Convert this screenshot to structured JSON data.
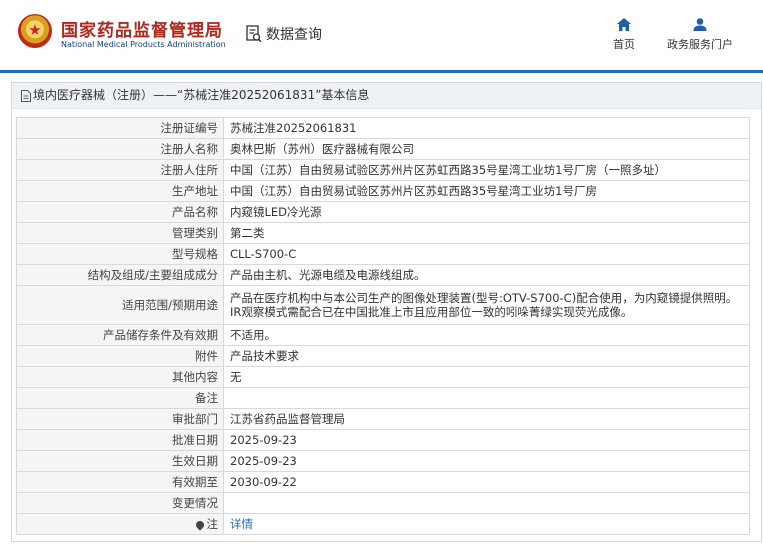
{
  "header": {
    "brand_cn": "国家药品监督管理局",
    "brand_en": "National Medical Products Administration",
    "query_label": "数据查询",
    "nav": [
      {
        "label": "首页",
        "icon": "home-icon"
      },
      {
        "label": "政务服务门户",
        "icon": "user-icon"
      }
    ],
    "accent": "#1b6fc0",
    "brand_color": "#b2271d"
  },
  "breadcrumb": "境内医疗器械（注册）——“苏械注准20252061831”基本信息",
  "fields": [
    {
      "label": "注册证编号",
      "value": "苏械注准20252061831"
    },
    {
      "label": "注册人名称",
      "value": "奥林巴斯（苏州）医疗器械有限公司"
    },
    {
      "label": "注册人住所",
      "value": "中国（江苏）自由贸易试验区苏州片区苏虹西路35号星湾工业坊1号厂房（一照多址）"
    },
    {
      "label": "生产地址",
      "value": "中国（江苏）自由贸易试验区苏州片区苏虹西路35号星湾工业坊1号厂房"
    },
    {
      "label": "产品名称",
      "value": "内窥镜LED冷光源"
    },
    {
      "label": "管理类别",
      "value": "第二类"
    },
    {
      "label": "型号规格",
      "value": "CLL-S700-C"
    },
    {
      "label": "结构及组成/主要组成成分",
      "value": "产品由主机、光源电缆及电源线组成。"
    },
    {
      "label": "适用范围/预期用途",
      "value": "产品在医疗机构中与本公司生产的图像处理装置(型号:OTV-S700-C)配合使用，为内窥镜提供照明。IR观察模式需配合已在中国批准上市且应用部位一致的吲哚菁绿实现荧光成像。"
    },
    {
      "label": "产品储存条件及有效期",
      "value": "不适用。"
    },
    {
      "label": "附件",
      "value": "产品技术要求"
    },
    {
      "label": "其他内容",
      "value": "无"
    },
    {
      "label": "备注",
      "value": ""
    },
    {
      "label": "审批部门",
      "value": "江苏省药品监督管理局"
    },
    {
      "label": "批准日期",
      "value": "2025-09-23"
    },
    {
      "label": "生效日期",
      "value": "2025-09-23"
    },
    {
      "label": "有效期至",
      "value": "2030-09-22"
    },
    {
      "label": "变更情况",
      "value": ""
    }
  ],
  "note": {
    "label": "注",
    "value": "详情"
  }
}
